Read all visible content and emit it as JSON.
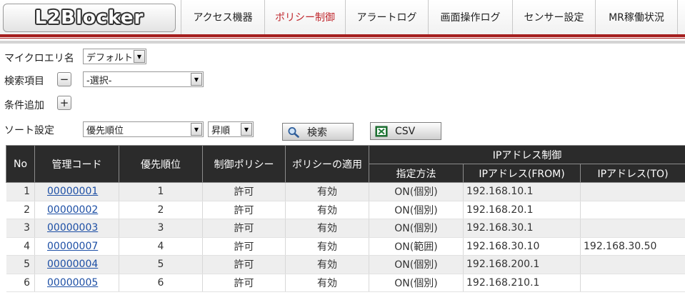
{
  "header": {
    "logo": "L2Blocker",
    "nav": [
      {
        "label": "アクセス機器",
        "active": false
      },
      {
        "label": "ポリシー制御",
        "active": true
      },
      {
        "label": "アラートログ",
        "active": false
      },
      {
        "label": "画面操作ログ",
        "active": false
      },
      {
        "label": "センサー設定",
        "active": false
      },
      {
        "label": "MR稼働状況",
        "active": false
      }
    ],
    "accent_color": "#a51e1e",
    "active_color": "#c0282e"
  },
  "form": {
    "micro_label": "マイクロエリ名",
    "micro_value": "デフォルト",
    "search_label": "検索項目",
    "remove_button": "−",
    "search_value": "-選択-",
    "add_condition_label": "条件追加",
    "add_button": "+",
    "sort_label": "ソート設定",
    "sort_value": "優先順位",
    "order_value": "昇順",
    "search_button": "検索",
    "csv_button": "CSV"
  },
  "table": {
    "headers": {
      "no": "No",
      "code": "管理コード",
      "priority": "優先順位",
      "policy": "制御ポリシー",
      "apply": "ポリシーの適用",
      "ip_group": "IPアドレス制御",
      "method": "指定方法",
      "ip_from": "IPアドレス(FROM)",
      "ip_to": "IPアドレス(TO)"
    },
    "rows": [
      {
        "no": "1",
        "code": "00000001",
        "priority": "1",
        "policy": "許可",
        "apply": "有効",
        "method": "ON(個別)",
        "ip_from": "192.168.10.1",
        "ip_to": ""
      },
      {
        "no": "2",
        "code": "00000002",
        "priority": "2",
        "policy": "許可",
        "apply": "有効",
        "method": "ON(個別)",
        "ip_from": "192.168.20.1",
        "ip_to": ""
      },
      {
        "no": "3",
        "code": "00000003",
        "priority": "3",
        "policy": "許可",
        "apply": "有効",
        "method": "ON(個別)",
        "ip_from": "192.168.30.1",
        "ip_to": ""
      },
      {
        "no": "4",
        "code": "00000007",
        "priority": "4",
        "policy": "許可",
        "apply": "有効",
        "method": "ON(範囲)",
        "ip_from": "192.168.30.10",
        "ip_to": "192.168.30.50"
      },
      {
        "no": "5",
        "code": "00000004",
        "priority": "5",
        "policy": "許可",
        "apply": "有効",
        "method": "ON(個別)",
        "ip_from": "192.168.200.1",
        "ip_to": ""
      },
      {
        "no": "6",
        "code": "00000005",
        "priority": "6",
        "policy": "許可",
        "apply": "有効",
        "method": "ON(個別)",
        "ip_from": "192.168.210.1",
        "ip_to": ""
      }
    ]
  }
}
